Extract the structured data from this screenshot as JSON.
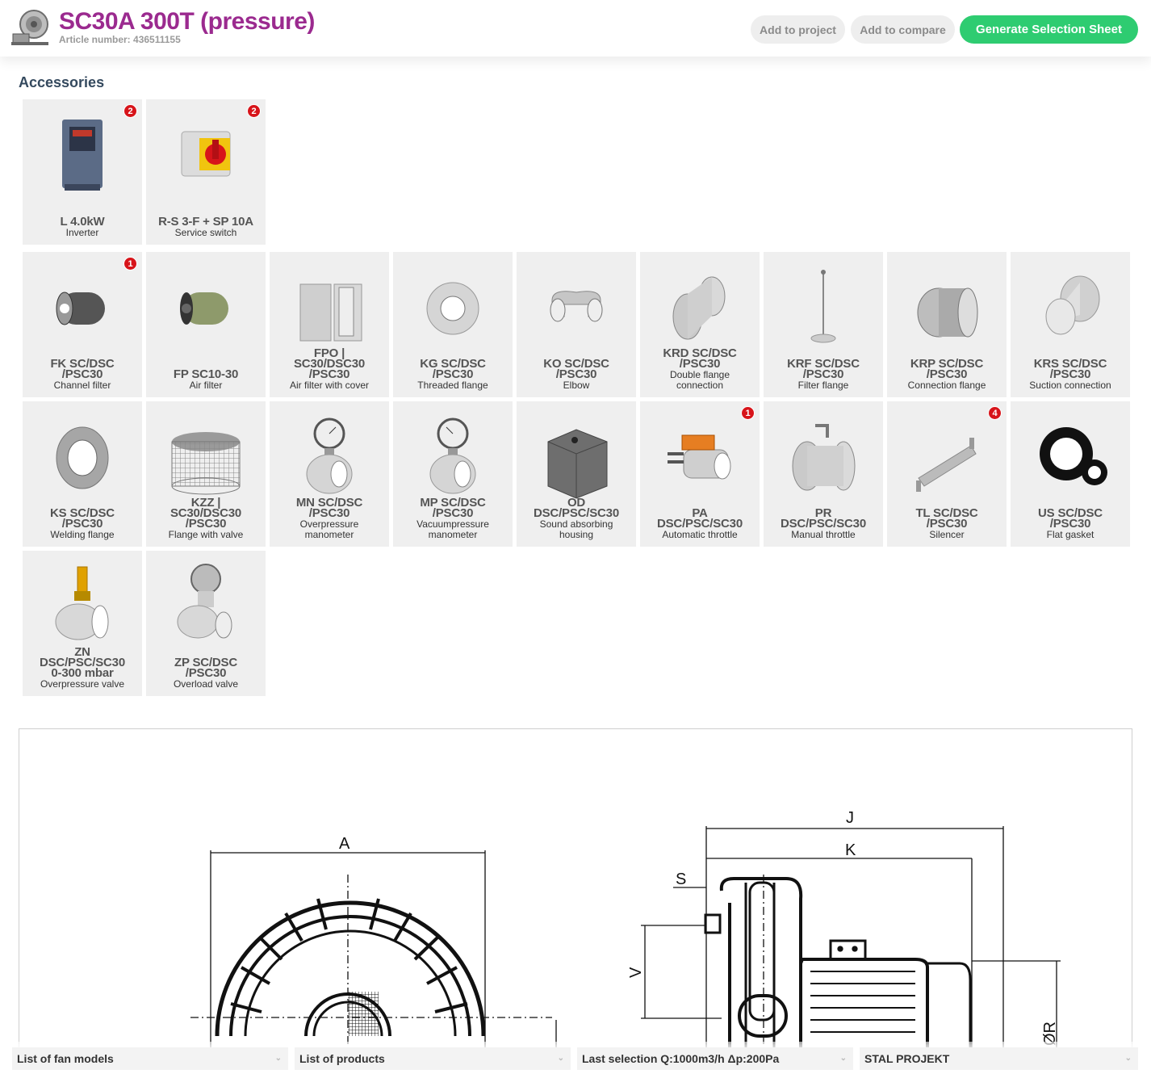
{
  "header": {
    "title": "SC30A 300T (pressure)",
    "article": "Article number: 436511155",
    "add_project": "Add to project",
    "add_compare": "Add to compare",
    "generate": "Generate Selection Sheet",
    "accent_color": "#9b2a8f",
    "button_color": "#2ecc71"
  },
  "accessories": {
    "title": "Accessories",
    "featured": [
      {
        "name": "L 4.0kW",
        "desc": "Inverter",
        "badge": "2",
        "icon": "inverter-icon"
      },
      {
        "name": "R-S 3-F + SP 10A",
        "desc": "Service switch",
        "badge": "2",
        "icon": "service-switch-icon"
      }
    ],
    "items": [
      {
        "name": "FK SC/DSC\n/PSC30",
        "desc": "Channel filter",
        "badge": "1",
        "icon": "channel-filter-icon"
      },
      {
        "name": "FP SC10-30",
        "desc": "Air filter",
        "badge": "",
        "icon": "air-filter-icon"
      },
      {
        "name": "FPO |\nSC30/DSC30\n/PSC30",
        "desc": "Air filter with cover",
        "badge": "",
        "icon": "air-filter-cover-icon"
      },
      {
        "name": "KG SC/DSC\n/PSC30",
        "desc": "Threaded flange",
        "badge": "",
        "icon": "threaded-flange-icon"
      },
      {
        "name": "KO SC/DSC\n/PSC30",
        "desc": "Elbow",
        "badge": "",
        "icon": "elbow-icon"
      },
      {
        "name": "KRD SC/DSC\n/PSC30",
        "desc": "Double flange\nconnection",
        "badge": "",
        "icon": "double-flange-icon"
      },
      {
        "name": "KRF SC/DSC\n/PSC30",
        "desc": "Filter flange",
        "badge": "",
        "icon": "filter-flange-icon"
      },
      {
        "name": "KRP SC/DSC\n/PSC30",
        "desc": "Connection flange",
        "badge": "",
        "icon": "connection-flange-icon"
      },
      {
        "name": "KRS SC/DSC\n/PSC30",
        "desc": "Suction connection",
        "badge": "",
        "icon": "suction-connection-icon"
      },
      {
        "name": "KS SC/DSC\n/PSC30",
        "desc": "Welding flange",
        "badge": "",
        "icon": "welding-flange-icon"
      },
      {
        "name": "KZZ |\nSC30/DSC30\n/PSC30",
        "desc": "Flange with valve",
        "badge": "",
        "icon": "flange-valve-icon"
      },
      {
        "name": "MN SC/DSC\n/PSC30",
        "desc": "Overpressure\nmanometer",
        "badge": "",
        "icon": "manometer-icon"
      },
      {
        "name": "MP SC/DSC\n/PSC30",
        "desc": "Vacuumpressure\nmanometer",
        "badge": "",
        "icon": "vacuum-manometer-icon"
      },
      {
        "name": "OD\nDSC/PSC/SC30",
        "desc": "Sound absorbing\nhousing",
        "badge": "",
        "icon": "housing-icon"
      },
      {
        "name": "PA\nDSC/PSC/SC30",
        "desc": "Automatic throttle",
        "badge": "1",
        "icon": "automatic-throttle-icon"
      },
      {
        "name": "PR\nDSC/PSC/SC30",
        "desc": "Manual throttle",
        "badge": "",
        "icon": "manual-throttle-icon"
      },
      {
        "name": "TL SC/DSC\n/PSC30",
        "desc": "Silencer",
        "badge": "4",
        "icon": "silencer-icon"
      },
      {
        "name": "US SC/DSC\n/PSC30",
        "desc": "Flat gasket",
        "badge": "",
        "icon": "flat-gasket-icon"
      },
      {
        "name": "ZN\nDSC/PSC/SC30\n0-300 mbar",
        "desc": "Overpressure valve",
        "badge": "",
        "icon": "overpressure-valve-icon"
      },
      {
        "name": "ZP SC/DSC\n/PSC30",
        "desc": "Overload valve",
        "badge": "",
        "icon": "overload-valve-icon"
      }
    ]
  },
  "drawing": {
    "labels": {
      "a": "A",
      "j": "J",
      "k": "K",
      "s": "S",
      "v": "V",
      "r": "ØR"
    }
  },
  "footer": {
    "fan_models": "List of fan models",
    "products": "List of products",
    "last_selection": "Last selection Q:1000m3/h Δp:200Pa",
    "company": "STAL PROJEKT"
  }
}
